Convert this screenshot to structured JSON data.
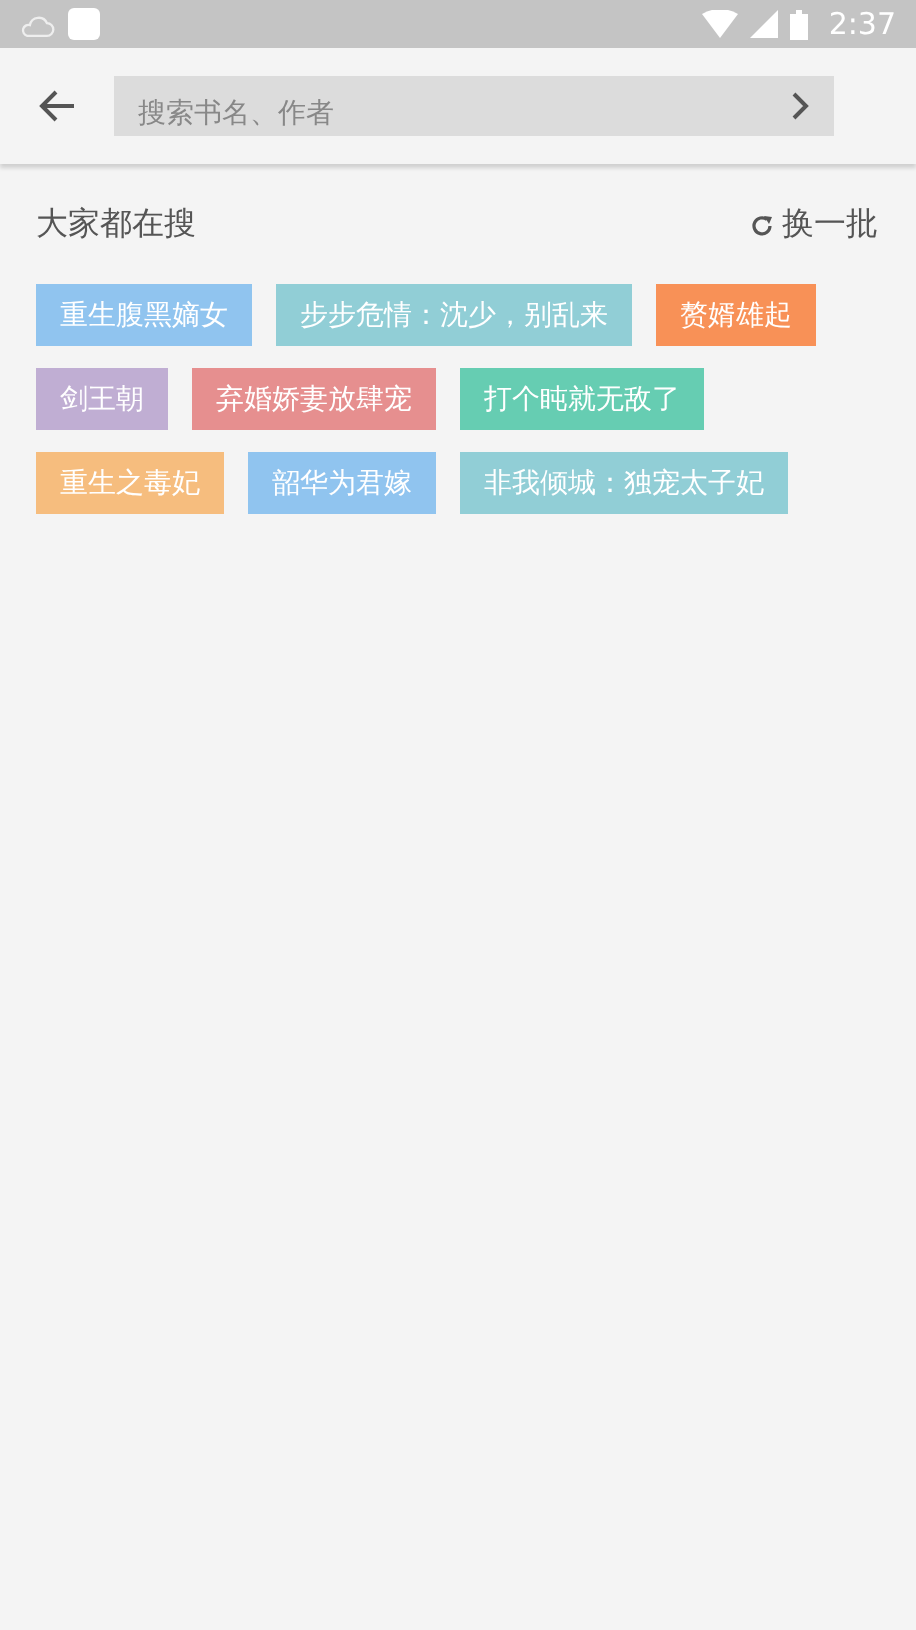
{
  "status_bar": {
    "time": "2:37"
  },
  "search": {
    "placeholder": "搜索书名、作者"
  },
  "hot": {
    "title": "大家都在搜",
    "refresh": "换一批",
    "tags": [
      {
        "label": "重生腹黑嫡女",
        "color": "#90c4ef"
      },
      {
        "label": "步步危情：沈少，别乱来",
        "color": "#91ced6"
      },
      {
        "label": "赘婿雄起",
        "color": "#f89157"
      },
      {
        "label": "剑王朝",
        "color": "#c0aed3"
      },
      {
        "label": "弃婚娇妻放肆宠",
        "color": "#e68f8f"
      },
      {
        "label": "打个盹就无敌了",
        "color": "#66cdb2"
      },
      {
        "label": "重生之毒妃",
        "color": "#f6bd7e"
      },
      {
        "label": "韶华为君嫁",
        "color": "#90c4ef"
      },
      {
        "label": "非我倾城：独宠太子妃",
        "color": "#91ced6"
      }
    ]
  }
}
